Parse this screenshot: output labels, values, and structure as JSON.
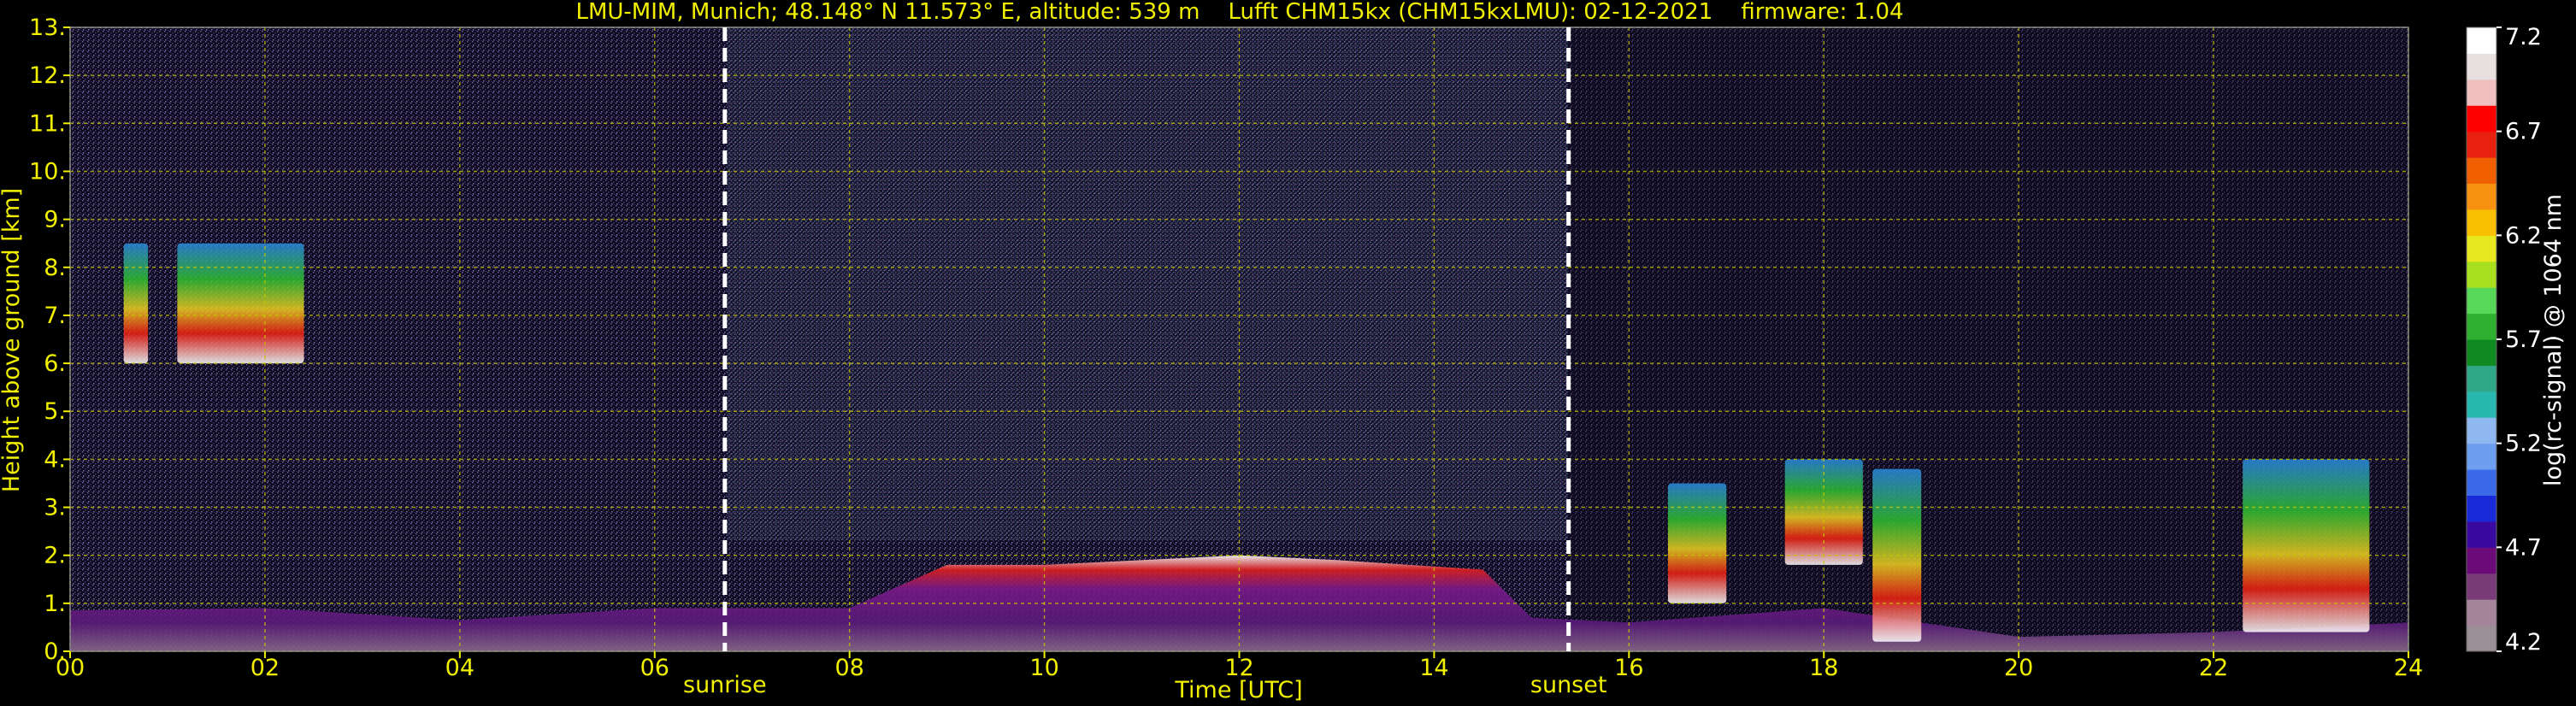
{
  "chart_data": {
    "type": "heatmap",
    "title": "LMU-MIM, Munich; 48.148° N 11.573° E, altitude: 539 m    Lufft CHM15kx (CHM15kxLMU): 02-12-2021    firmware: 1.04",
    "xlabel": "Time [UTC]",
    "ylabel": "Height above ground [km]",
    "colorbar_label": "log(rc-signal) @ 1064 nm",
    "xlim": [
      0,
      24
    ],
    "ylim": [
      0,
      13
    ],
    "x_ticks": [
      0,
      2,
      4,
      6,
      8,
      10,
      12,
      14,
      16,
      18,
      20,
      22,
      24
    ],
    "x_tick_labels": [
      "00",
      "02",
      "04",
      "06",
      "08",
      "10",
      "12",
      "14",
      "16",
      "18",
      "20",
      "22",
      "24"
    ],
    "y_ticks": [
      0,
      1,
      2,
      3,
      4,
      5,
      6,
      7,
      8,
      9,
      10,
      11,
      12,
      13
    ],
    "y_tick_labels": [
      "0.",
      "1.",
      "2.",
      "3.",
      "4.",
      "5.",
      "6.",
      "7.",
      "8.",
      "9.",
      "10.",
      "11.",
      "12.",
      "13."
    ],
    "grid": true,
    "colorbar_range": [
      4.2,
      7.2
    ],
    "colorbar_ticks": [
      4.2,
      4.7,
      5.2,
      5.7,
      6.2,
      6.7,
      7.2
    ],
    "colorbar_tick_labels": [
      "4.2",
      "4.7",
      "5.2",
      "5.7",
      "6.2",
      "6.7",
      "7.2"
    ],
    "colorbar_colors": [
      "#9a8f95",
      "#a5859c",
      "#7a3a78",
      "#6b0a78",
      "#3a0aa0",
      "#1a2ad8",
      "#3a6ae8",
      "#6e9ef0",
      "#8fb8f0",
      "#28b8b0",
      "#30a888",
      "#108a20",
      "#30b030",
      "#58d858",
      "#a8e020",
      "#e8e820",
      "#f8c000",
      "#f89010",
      "#f06000",
      "#e82010",
      "#ff0000",
      "#f0c0c0",
      "#e8e0e0",
      "#ffffff"
    ],
    "annotations": [
      {
        "label": "sunrise",
        "x": 6.72
      },
      {
        "label": "sunset",
        "x": 15.38
      }
    ],
    "cloud_layers": [
      {
        "x0": 0.55,
        "x1": 0.8,
        "y0": 6.0,
        "y1": 8.5
      },
      {
        "x0": 1.1,
        "x1": 2.4,
        "y0": 6.0,
        "y1": 8.5
      },
      {
        "x0": 16.4,
        "x1": 17.0,
        "y0": 1.0,
        "y1": 3.5
      },
      {
        "x0": 17.6,
        "x1": 18.4,
        "y0": 1.8,
        "y1": 4.0
      },
      {
        "x0": 18.5,
        "x1": 19.0,
        "y0": 0.2,
        "y1": 3.8
      },
      {
        "x0": 22.3,
        "x1": 23.6,
        "y0": 0.4,
        "y1": 4.0
      }
    ],
    "boundary_layer_top": [
      {
        "x": 0.0,
        "y": 0.85
      },
      {
        "x": 2.0,
        "y": 0.9
      },
      {
        "x": 4.0,
        "y": 0.65
      },
      {
        "x": 6.0,
        "y": 0.9
      },
      {
        "x": 8.0,
        "y": 0.9
      },
      {
        "x": 9.0,
        "y": 1.8
      },
      {
        "x": 10.0,
        "y": 1.8
      },
      {
        "x": 12.0,
        "y": 2.0
      },
      {
        "x": 13.0,
        "y": 1.9
      },
      {
        "x": 14.5,
        "y": 1.7
      },
      {
        "x": 15.0,
        "y": 0.7
      },
      {
        "x": 16.0,
        "y": 0.6
      },
      {
        "x": 18.0,
        "y": 0.9
      },
      {
        "x": 20.0,
        "y": 0.3
      },
      {
        "x": 22.0,
        "y": 0.4
      },
      {
        "x": 24.0,
        "y": 0.6
      }
    ],
    "colors": {
      "text": "#f0f000",
      "grid": "#c8c800",
      "background": "#000000",
      "noise": "#3a2a5e",
      "colorbar_text": "#ffffff"
    }
  }
}
